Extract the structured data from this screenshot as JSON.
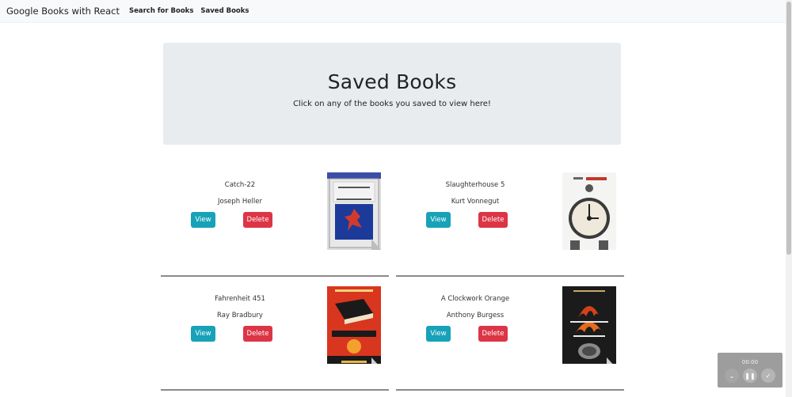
{
  "navbar": {
    "brand": "Google Books with React",
    "links": [
      "Search for Books",
      "Saved Books"
    ]
  },
  "jumbotron": {
    "title": "Saved Books",
    "subtitle": "Click on any of the books you saved to view here!"
  },
  "books": [
    {
      "title": "Catch-22",
      "author": "Joseph Heller",
      "view_label": "View",
      "delete_label": "Delete",
      "cover_icon": "catch-22-cover"
    },
    {
      "title": "Slaughterhouse 5",
      "author": "Kurt Vonnegut",
      "view_label": "View",
      "delete_label": "Delete",
      "cover_icon": "slaughterhouse-5-cover"
    },
    {
      "title": "Fahrenheit 451",
      "author": "Ray Bradbury",
      "view_label": "View",
      "delete_label": "Delete",
      "cover_icon": "fahrenheit-451-cover"
    },
    {
      "title": "A Clockwork Orange",
      "author": "Anthony Burgess",
      "view_label": "View",
      "delete_label": "Delete",
      "cover_icon": "clockwork-orange-cover"
    }
  ],
  "recorder": {
    "time": "00:00"
  },
  "colors": {
    "view": "#17a2b8",
    "delete": "#dc3545",
    "navbar_bg": "#f8f9fa",
    "jumbotron_bg": "#e9ecef"
  }
}
